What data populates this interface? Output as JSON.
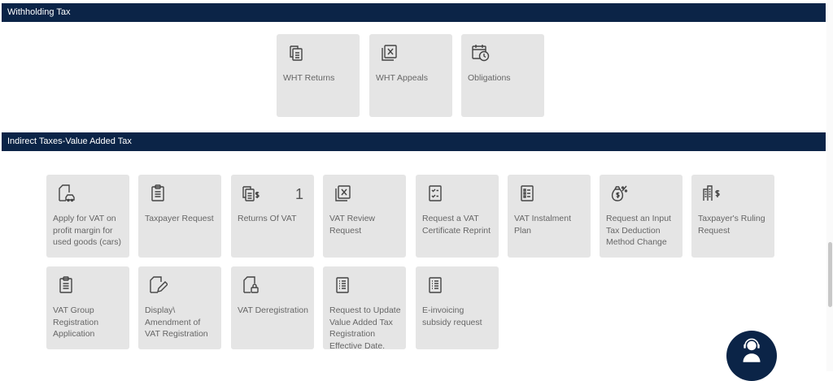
{
  "sections": {
    "withholding": {
      "title": "Withholding Tax"
    },
    "vat": {
      "title": "Indirect Taxes-Value Added Tax"
    }
  },
  "wht_tiles": [
    {
      "label": "WHT Returns",
      "icon": "document-stack-icon"
    },
    {
      "label": "WHT Appeals",
      "icon": "document-x-icon"
    },
    {
      "label": "Obligations",
      "icon": "calendar-clock-icon"
    }
  ],
  "vat_tiles": [
    {
      "label": "Apply for VAT on profit margin for used goods (cars)",
      "icon": "document-car-icon"
    },
    {
      "label": "Taxpayer Request",
      "icon": "clipboard-icon"
    },
    {
      "label": "Returns Of VAT",
      "icon": "document-dollar-icon",
      "count": "1"
    },
    {
      "label": "VAT Review Request",
      "icon": "document-x-icon"
    },
    {
      "label": "Request a VAT Certificate Reprint",
      "icon": "checklist-icon"
    },
    {
      "label": "VAT Instalment Plan",
      "icon": "list-icon"
    },
    {
      "label": "Request an Input Tax Deduction Method Change",
      "icon": "money-bag-percent-icon"
    },
    {
      "label": "Taxpayer's Ruling Request",
      "icon": "building-dollar-icon"
    },
    {
      "label": "VAT Group Registration Application",
      "icon": "clipboard-icon"
    },
    {
      "label": "Display\\ Amendment of VAT Registration",
      "icon": "document-edit-icon"
    },
    {
      "label": "VAT Deregistration",
      "icon": "document-lock-icon"
    },
    {
      "label": "Request to Update Value Added Tax Registration Effective Date.",
      "icon": "list-document-icon"
    },
    {
      "label": "E-invoicing subsidy request",
      "icon": "list-document-icon"
    }
  ],
  "colors": {
    "section_bar": "#0b2447",
    "tile_bg": "#e5e5e5",
    "icon_stroke": "#444444"
  }
}
